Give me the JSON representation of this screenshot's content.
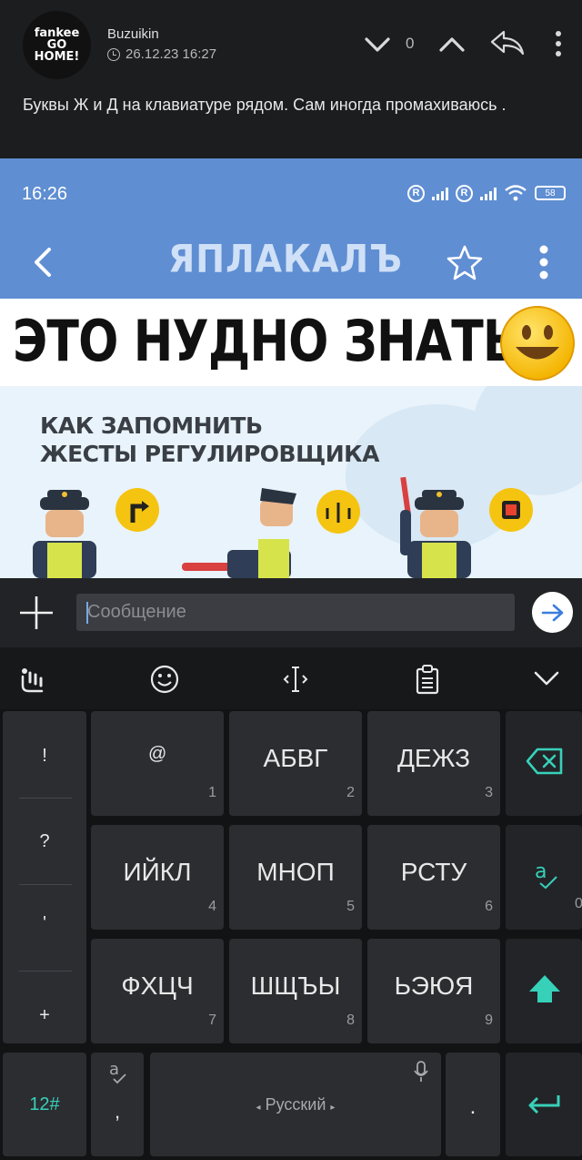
{
  "post": {
    "avatar_lines": [
      "fankee",
      "GO",
      "HOME!"
    ],
    "username": "Buzuikin",
    "timestamp": "26.12.23 16:27",
    "vote_count": "0",
    "text": "Буквы Ж и Д на клавиатуре рядом. Сам иногда промахиваюсь ."
  },
  "embedded_image": {
    "time": "16:26",
    "battery": "58",
    "logo": "ЯПЛАКАЛЪ",
    "banner": "ЭТО НУДНО ЗНАТЬ!",
    "illustration_title": "КАК ЗАПОМНИТЬ\nЖЕСТЫ РЕГУЛИРОВЩИКА"
  },
  "composer": {
    "placeholder": "Сообщение"
  },
  "keyboard": {
    "punctuation": [
      "!",
      "?",
      "'",
      "+"
    ],
    "keys": [
      {
        "label": "@",
        "num": "1"
      },
      {
        "label": "АБВГ",
        "num": "2"
      },
      {
        "label": "ДЕЖЗ",
        "num": "3"
      },
      {
        "label": "ИЙКЛ",
        "num": "4"
      },
      {
        "label": "МНОП",
        "num": "5"
      },
      {
        "label": "РСТУ",
        "num": "6"
      },
      {
        "label": "ФХЦЧ",
        "num": "7"
      },
      {
        "label": "ШЩЪЫ",
        "num": "8"
      },
      {
        "label": "ЬЭЮЯ",
        "num": "9"
      }
    ],
    "zero": "0",
    "mode_key": "12#",
    "comma": ",",
    "space_label": "Русский",
    "dot": ".",
    "accent_color": "#37d1b9"
  }
}
